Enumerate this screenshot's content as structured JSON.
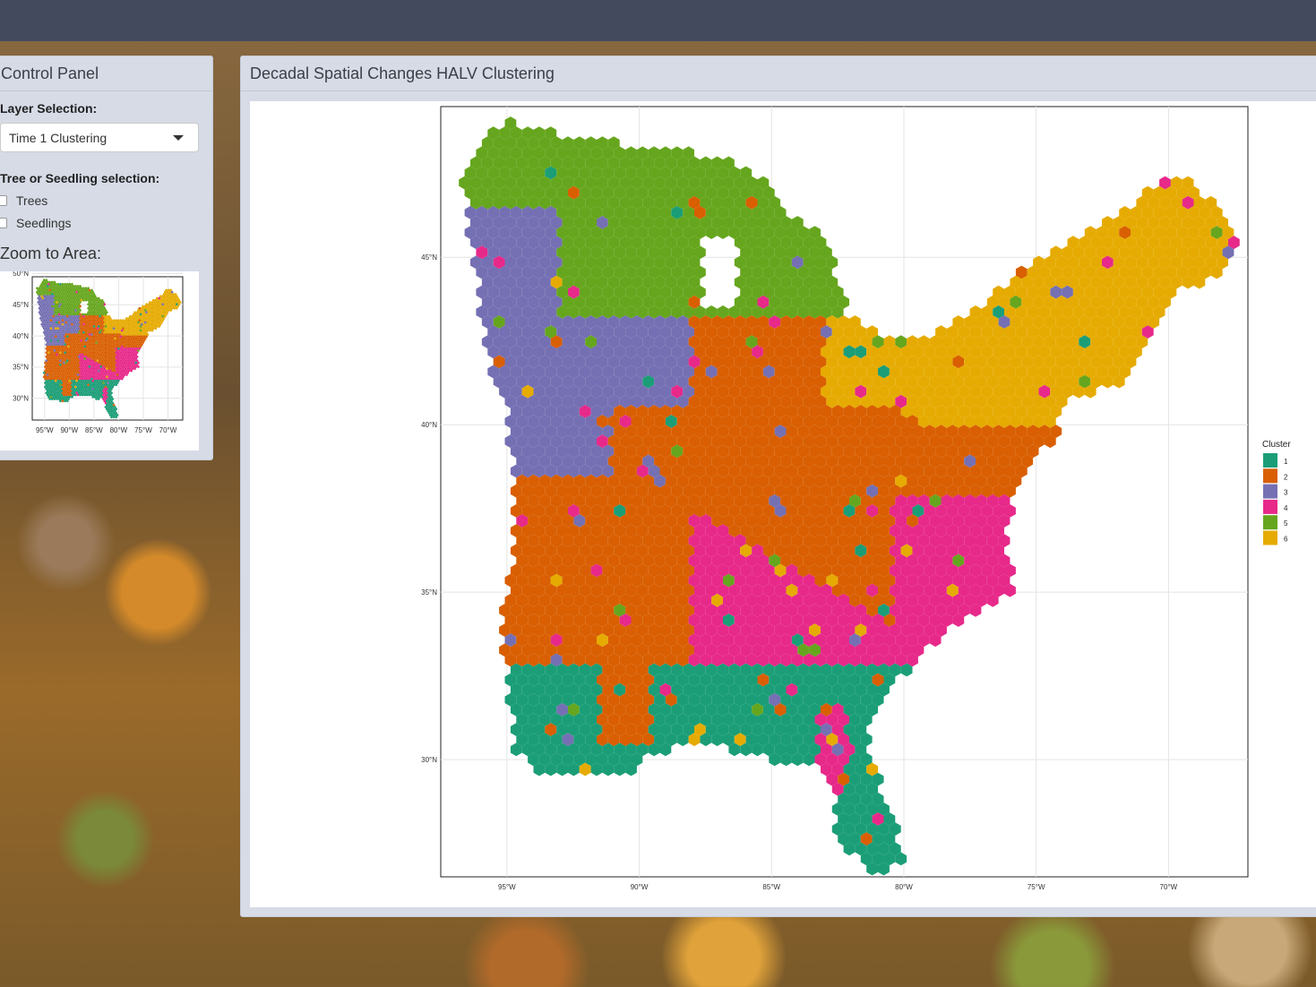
{
  "control_panel": {
    "title": "Control Panel",
    "layer_label": "Layer Selection:",
    "layer_value": "Time 1 Clustering",
    "tree_label": "Tree or Seedling selection:",
    "options": [
      "Trees",
      "Seedlings"
    ],
    "zoom_label": "Zoom to Area:",
    "mini_map": {
      "y_ticks": [
        "50°N",
        "45°N",
        "40°N",
        "35°N",
        "30°N"
      ],
      "x_ticks": [
        "95°W",
        "90°W",
        "85°W",
        "80°W",
        "75°W",
        "70°W"
      ]
    }
  },
  "main_panel": {
    "title": "Decadal Spatial Changes HALV Clustering"
  },
  "chart_data": {
    "type": "heatmap",
    "x_ticks": [
      "95°W",
      "90°W",
      "85°W",
      "80°W",
      "75°W",
      "70°W"
    ],
    "y_ticks": [
      "45°N",
      "40°N",
      "35°N",
      "30°N"
    ],
    "xlim": [
      -97.5,
      -67
    ],
    "ylim": [
      26.5,
      49.5
    ],
    "grid": true,
    "legend": {
      "title": "Cluster",
      "placement": "right",
      "entries": [
        {
          "label": "1",
          "color": "#1b9e77"
        },
        {
          "label": "2",
          "color": "#d95f02"
        },
        {
          "label": "3",
          "color": "#7570b3"
        },
        {
          "label": "4",
          "color": "#e7298a"
        },
        {
          "label": "5",
          "color": "#66a61e"
        },
        {
          "label": "6",
          "color": "#e6ab02"
        }
      ]
    }
  }
}
